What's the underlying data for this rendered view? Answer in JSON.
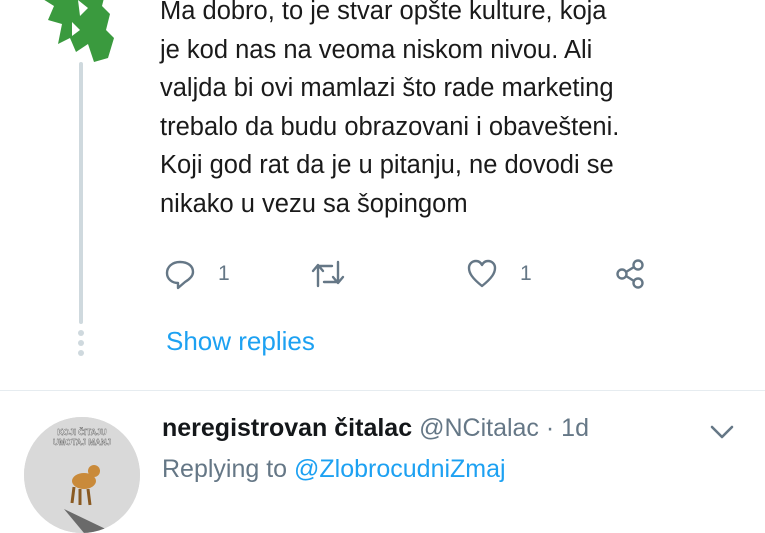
{
  "tweet": {
    "lines": [
      "Ma dobro, to je stvar opšte kulture, koja",
      "je kod nas na veoma niskom nivou. Ali",
      "valjda bi ovi mamlazi što rade marketing",
      "trebalo da budu obrazovani i obavešteni.",
      "Koji god rat da je u pitanju, ne dovodi se",
      "nikako u vezu sa šopingom"
    ],
    "actions": {
      "reply_icon": "reply-icon",
      "reply_count": "1",
      "retweet_icon": "retweet-icon",
      "like_icon": "heart-icon",
      "like_count": "1",
      "share_icon": "share-icon"
    }
  },
  "show_replies": "Show replies",
  "reply": {
    "name": "neregistrovan čitalac",
    "handle": "@NCitalac",
    "separator": "·",
    "time": "1d",
    "replying_prefix": "Replying to ",
    "replying_to": "@ZlobrocudniZmaj",
    "avatar_text_line1": "KOJI ČITAJU",
    "avatar_text_line2": "UMOTAJ MANJ"
  },
  "colors": {
    "link": "#1da1f2",
    "muted": "#657786",
    "thread_line": "#cfd9de",
    "dino": "#3a9a3e"
  }
}
